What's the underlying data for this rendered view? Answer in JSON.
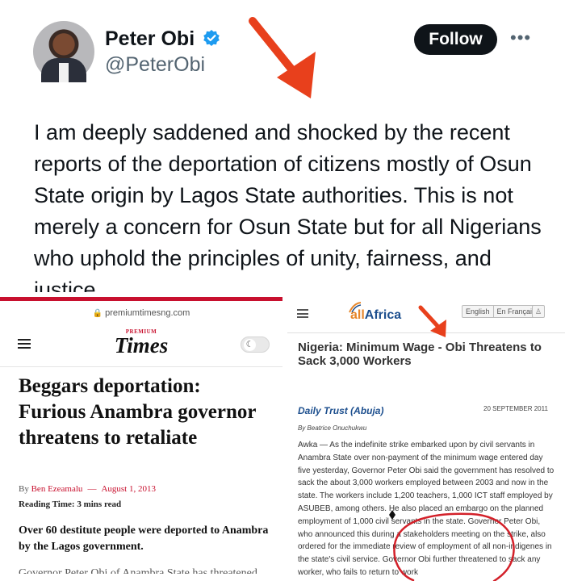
{
  "tweet": {
    "name": "Peter Obi",
    "handle": "@PeterObi",
    "follow_label": "Follow",
    "more_label": "•••",
    "text": "I am deeply saddened and shocked by the recent reports of the deportation of citizens mostly of Osun State origin by Lagos State authorities. This is not merely a concern for Osun State but for all Nigerians who uphold the principles of unity, fairness, and justice."
  },
  "premium_times": {
    "url": "premiumtimesng.com",
    "logo_small": "PREMIUM",
    "logo_main": "Times",
    "headline": "Beggars deportation: Furious Anambra governor threatens to retaliate",
    "meta_by": "By",
    "author": "Ben Ezeamalu",
    "meta_dash": "—",
    "date": "August 1, 2013",
    "reading_time": "Reading Time: 3 mins read",
    "lead": "Over 60 destitute people were deported to Anambra by the Lagos government.",
    "cut_text": "Governor Peter Obi of Anambra State has threatened to"
  },
  "allafrica": {
    "logo_prefix": "all",
    "logo_suffix": "Africa",
    "lang_english": "English",
    "lang_french": "En Français",
    "headline": "Nigeria: Minimum Wage - Obi Threatens to Sack 3,000 Workers",
    "source": "Daily Trust (Abuja)",
    "date": "20 SEPTEMBER 2011",
    "byline": "By Beatrice Onuchukwu",
    "body": "Awka — As the indefinite strike embarked upon by civil servants in Anambra State over non-payment of the minimum wage entered day five yesterday, Governor Peter Obi said the government has resolved to sack the about 3,000 workers employed between 2003 and now in the state. The workers include 1,200 teachers, 1,000 ICT staff employed by ASUBEB, among others. He also placed an embargo on the planned employment of 1,000 civil servants in the state. Governor Peter Obi, who announced this during a stakeholders meeting on the strike, also ordered for the immediate review of employment of all non-indigenes in the state's civil service. Governor Obi further threatened to sack any worker, who fails to return to work"
  },
  "colors": {
    "annotation_red": "#e8401c",
    "circle_red": "#d3212a",
    "twitter_blue": "#1d9bf0",
    "pt_red": "#c8102e",
    "allafrica_blue": "#1d4f8e"
  }
}
